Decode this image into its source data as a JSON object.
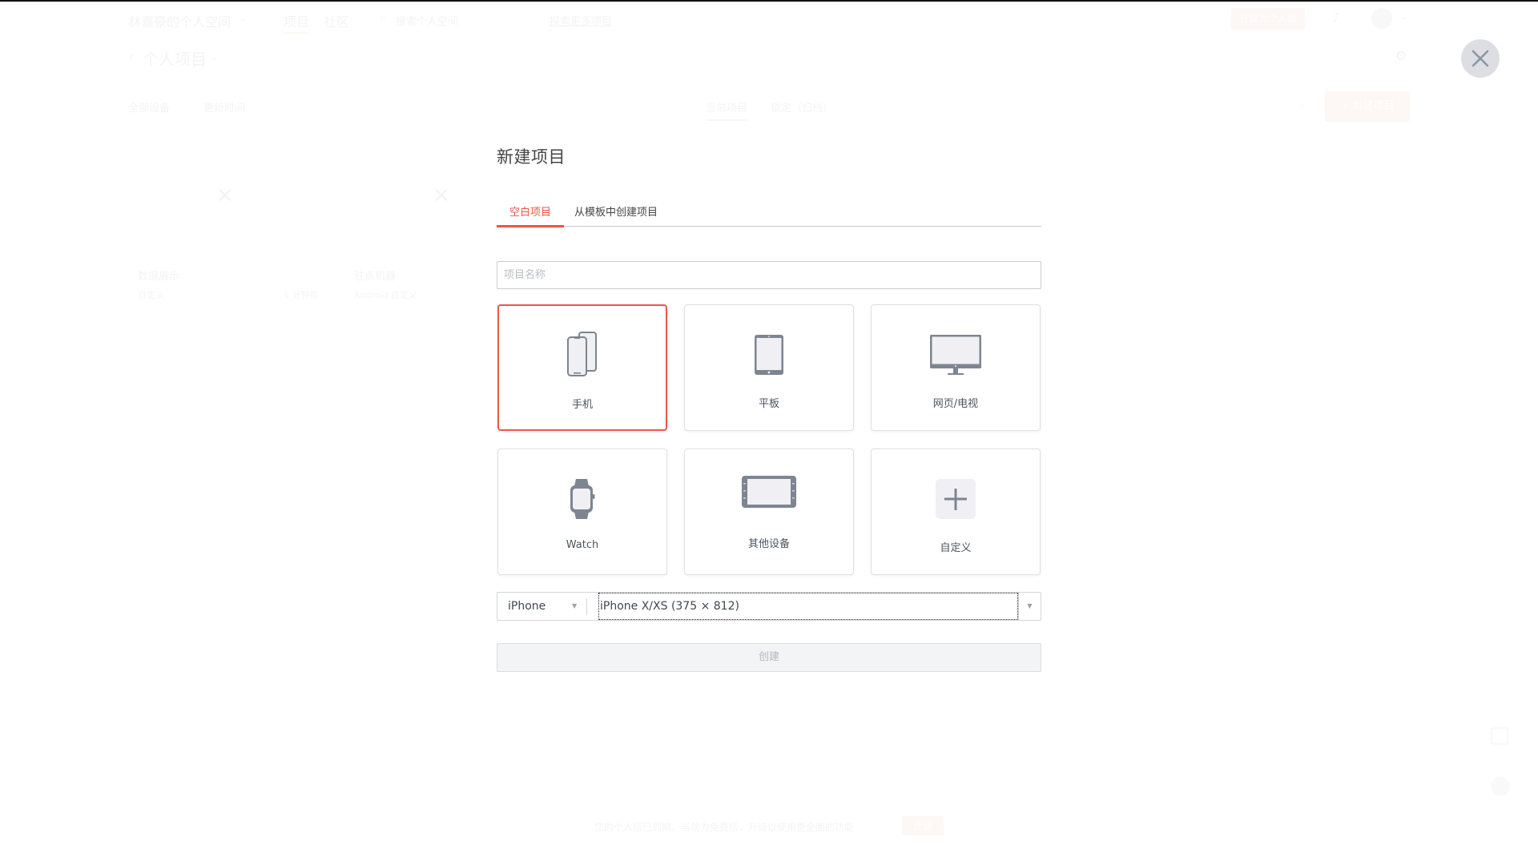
{
  "background": {
    "space_name": "林嘉豪的个人空间",
    "nav": {
      "project": "项目",
      "community": "社区"
    },
    "search_placeholder": "搜索个人空间",
    "center_link": "探索更多项目",
    "upgrade_top": "升级为个人版",
    "folder_title": "个人项目",
    "filters": {
      "device": "全部设备",
      "time": "更新时间"
    },
    "tabs": {
      "current": "当前项目",
      "locked": "锁定（归档）"
    },
    "new_project_button": "+ 新建项目",
    "projects": [
      {
        "title": "数据展示",
        "type": "自定义",
        "time": "1 分钟前"
      },
      {
        "title": "驻点机器",
        "type": "Android 自定义"
      }
    ],
    "notice": "您的个人版已到期，当前为免费版，升级以使用更全面的功能",
    "notice_button": "升级"
  },
  "modal": {
    "title": "新建项目",
    "tabs": [
      {
        "label": "空白项目",
        "active": true
      },
      {
        "label": "从模板中创建项目",
        "active": false
      }
    ],
    "name_input": {
      "value": "",
      "placeholder": "项目名称"
    },
    "devices": [
      {
        "label": "手机",
        "icon": "phone-icon",
        "selected": true
      },
      {
        "label": "平板",
        "icon": "tablet-icon",
        "selected": false
      },
      {
        "label": "网页/电视",
        "icon": "monitor-icon",
        "selected": false
      },
      {
        "label": "Watch",
        "icon": "watch-icon",
        "selected": false
      },
      {
        "label": "其他设备",
        "icon": "other-device-icon",
        "selected": false
      },
      {
        "label": "自定义",
        "icon": "plus-icon",
        "selected": false
      }
    ],
    "device_family_select": "iPhone",
    "device_model_select": "iPhone X/XS (375 × 812)",
    "create_button": "创建"
  },
  "colors": {
    "accent": "#e9574a",
    "icon": "#7d8590",
    "icon_fill": "#f0f0f4"
  }
}
